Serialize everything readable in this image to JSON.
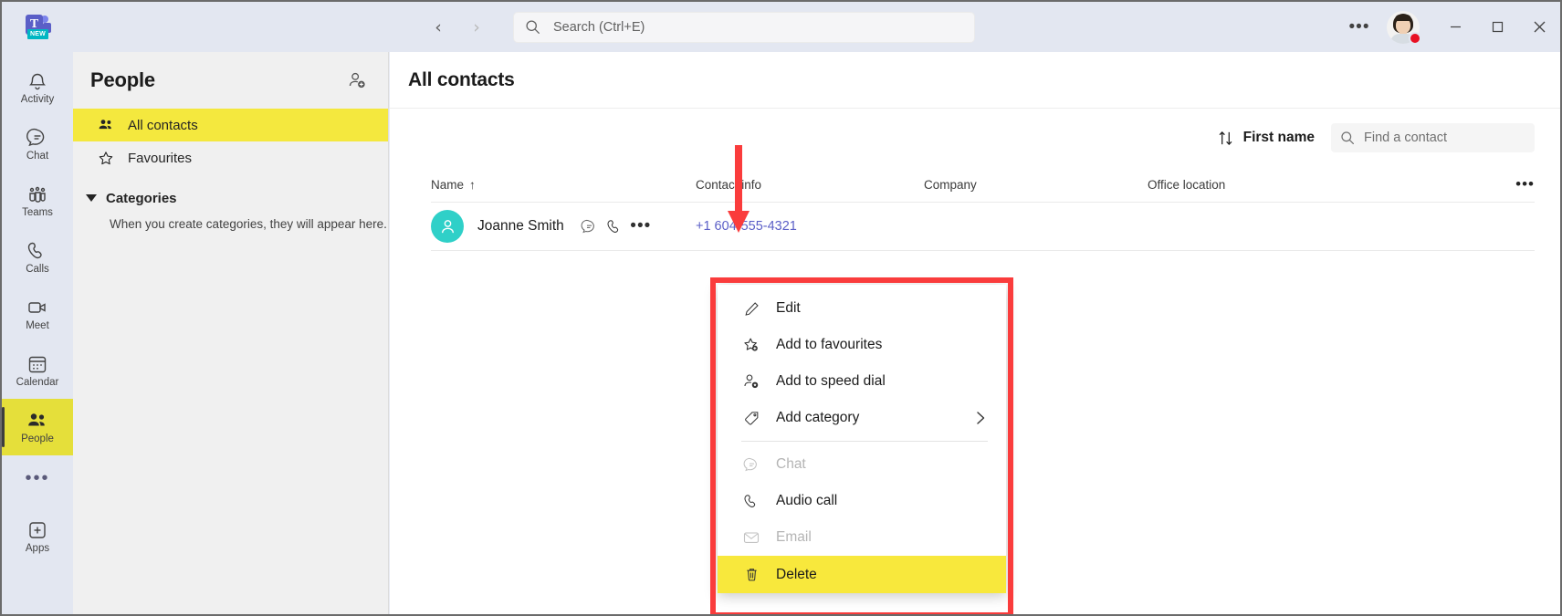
{
  "titlebar": {
    "logo_name": "microsoft-teams-logo",
    "logo_letter": "T",
    "logo_badge": "NEW",
    "back_label": "‹",
    "forward_label": "›",
    "search_placeholder": "Search (Ctrl+E)",
    "more_label": "•••",
    "presence_color": "#e81123",
    "presence_status": "busy",
    "minimize_label": "–",
    "maximize_label": "□",
    "close_label": "✕"
  },
  "rail": {
    "items": [
      {
        "label": "Activity",
        "icon": "bell-icon",
        "active": false
      },
      {
        "label": "Chat",
        "icon": "chat-icon",
        "active": false
      },
      {
        "label": "Teams",
        "icon": "teams-icon",
        "active": false
      },
      {
        "label": "Calls",
        "icon": "phone-icon",
        "active": false
      },
      {
        "label": "Meet",
        "icon": "video-camera-icon",
        "active": false
      },
      {
        "label": "Calendar",
        "icon": "calendar-icon",
        "active": false
      },
      {
        "label": "People",
        "icon": "people-icon",
        "active": true
      }
    ],
    "more_label": "•••",
    "apps_label": "Apps",
    "active_highlight_color": "#e5df3a"
  },
  "sidebar": {
    "title": "People",
    "add_contact_icon": "add-person-icon",
    "items": [
      {
        "label": "All contacts",
        "icon": "people-icon",
        "selected": true
      },
      {
        "label": "Favourites",
        "icon": "star-icon",
        "selected": false
      }
    ],
    "categories_label": "Categories",
    "categories_empty_text": "When you create categories, they will appear here.",
    "selected_highlight_color": "#f4e83e"
  },
  "main": {
    "title": "All contacts",
    "toolbar": {
      "sort_icon": "sort-arrows-icon",
      "sort_label": "First name",
      "find_placeholder": "Find a contact",
      "find_icon": "search-icon"
    },
    "table": {
      "columns": [
        "Name",
        "Contact info",
        "Company",
        "Office location"
      ],
      "name_sort_indicator": "↑",
      "more_label": "•••",
      "rows": [
        {
          "name": "Joanne Smith",
          "avatar_color": "#2fd0c8",
          "contact_info": "+1 604-555-4321",
          "company": "",
          "office_location": "",
          "chat_icon": "chat-icon",
          "call_icon": "phone-icon",
          "more_icon": "more-options-icon",
          "more_label": "•••"
        }
      ]
    }
  },
  "context_menu": {
    "items": [
      {
        "label": "Edit",
        "icon": "pencil-icon",
        "state": "enabled"
      },
      {
        "label": "Add to favourites",
        "icon": "star-add-icon",
        "state": "enabled"
      },
      {
        "label": "Add to speed dial",
        "icon": "person-add-icon",
        "state": "enabled"
      },
      {
        "label": "Add category",
        "icon": "tag-icon",
        "state": "enabled",
        "submenu_chevron": "›"
      },
      {
        "separator": true
      },
      {
        "label": "Chat",
        "icon": "chat-icon",
        "state": "disabled"
      },
      {
        "label": "Audio call",
        "icon": "phone-icon",
        "state": "enabled"
      },
      {
        "label": "Email",
        "icon": "envelope-icon",
        "state": "disabled"
      },
      {
        "label": "Delete",
        "icon": "trash-icon",
        "state": "highlighted"
      }
    ],
    "highlight_color": "#f8e83c"
  },
  "annotations": {
    "box_color": "#fa3c3c",
    "arrow_color": "#fa3c3c"
  }
}
